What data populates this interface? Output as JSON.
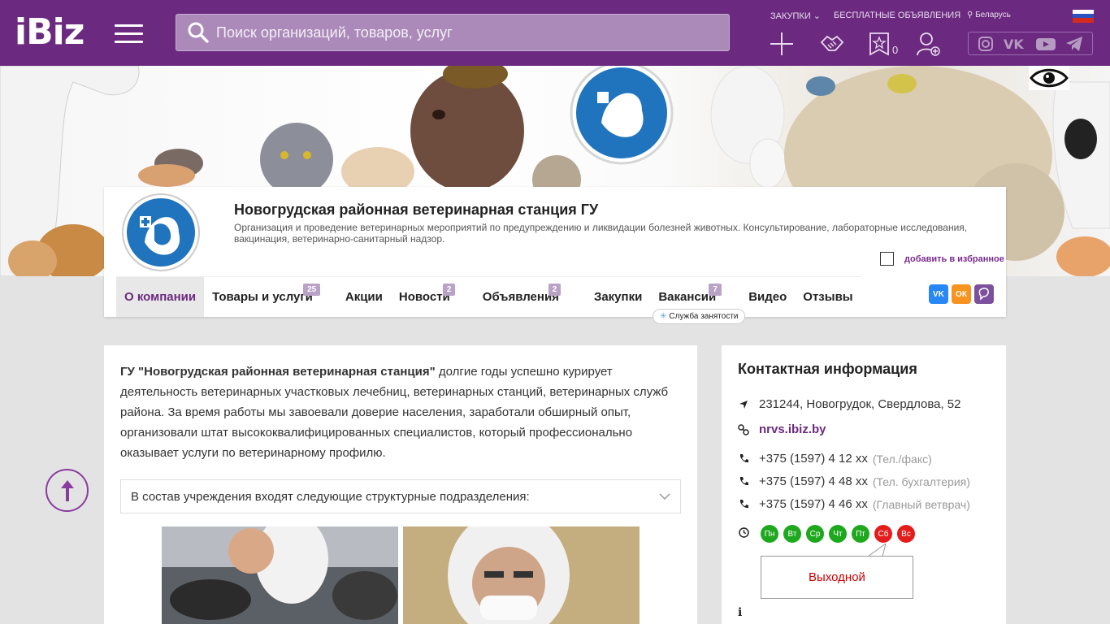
{
  "header": {
    "logo": "iBiz",
    "search_placeholder": "Поиск организаций, товаров, услуг",
    "links": {
      "purchases": "ЗАКУПКИ",
      "free_ads": "БЕСПЛАТНЫЕ ОБЪЯВЛЕНИЯ",
      "region": "Беларусь"
    },
    "favorites_count": "0"
  },
  "company": {
    "title": "Новогрудская районная ветеринарная станция ГУ",
    "description": "Организация и проведение ветеринарных мероприятий по предупреждению и ликвидации болезней животных. Консультирование, лабораторные исследования, вакцинация, ветеринарно-санитарный надзор.",
    "favorite_label": "добавить в избранное"
  },
  "tabs": [
    {
      "label": "О компании",
      "badge": ""
    },
    {
      "label": "Товары и услуги",
      "badge": "25"
    },
    {
      "label": "Акции",
      "badge": ""
    },
    {
      "label": "Новости",
      "badge": "2"
    },
    {
      "label": "Объявления",
      "badge": "2"
    },
    {
      "label": "Закупки",
      "badge": ""
    },
    {
      "label": "Вакансии",
      "badge": "7"
    },
    {
      "label": "Видео",
      "badge": ""
    },
    {
      "label": "Отзывы",
      "badge": ""
    }
  ],
  "tooltip": "Служба занятости",
  "main": {
    "intro_bold": "ГУ \"Новогрудская районная ветеринарная станция\"",
    "intro_text": " долгие годы успешно курирует деятельность ветеринарных участковых лечебниц, ветеринарных станций, ветеринарных служб района. За время работы мы завоевали доверие населения, заработали обширный опыт, организовали штат высококвалифицированных специалистов, который профессионально оказывает услуги по ветеринарному профилю.",
    "accordion": "В состав учреждения входят следующие структурные подразделения:"
  },
  "contacts": {
    "title": "Контактная информация",
    "address": "231244, Новогрудок, Свердлова, 52",
    "site": "nrvs.ibiz.by",
    "phones": [
      {
        "number": "+375 (1597) 4 12 xx",
        "note": "(Тел./факс)"
      },
      {
        "number": "+375 (1597) 4 48 xx",
        "note": "(Тел. бухгалтерия)"
      },
      {
        "number": "+375 (1597) 4 46 xx",
        "note": "(Главный ветврач)"
      }
    ],
    "days": [
      "Пн",
      "Вт",
      "Ср",
      "Чт",
      "Пт",
      "Сб",
      "Вс"
    ],
    "dayoff": "Выходной"
  },
  "colors": {
    "brand": "#6b2a7f",
    "open": "#1ea81e",
    "closed": "#e51c1c"
  }
}
